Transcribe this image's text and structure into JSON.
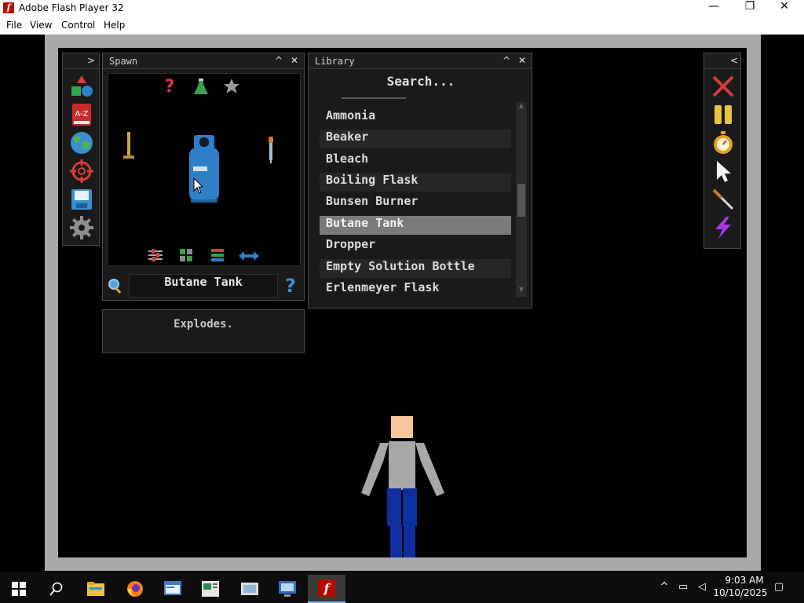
{
  "window": {
    "title": "Adobe Flash Player 32",
    "minimize_glyph": "—",
    "restore_glyph": "❐",
    "close_glyph": "✕"
  },
  "menu": [
    "File",
    "View",
    "Control",
    "Help"
  ],
  "categories": {
    "expand_glyph": ">",
    "icons": [
      "shapes-icon",
      "a-z-icon",
      "globe-icon",
      "crosshair-icon",
      "save-icon",
      "gear-icon"
    ],
    "az_label": "A-Z"
  },
  "spawn": {
    "title": "Spawn",
    "collapse_glyph": "^",
    "close_glyph": "✕",
    "selected_item": "Butane Tank",
    "description": "Explodes.",
    "help_glyph": "?",
    "random_glyph": "?"
  },
  "library": {
    "title": "Library",
    "collapse_glyph": "^",
    "close_glyph": "✕",
    "search_placeholder": "Search...",
    "items": [
      "Ammonia",
      "Beaker",
      "Bleach",
      "Boiling Flask",
      "Bunsen Burner",
      "Butane Tank",
      "Dropper",
      "Empty Solution Bottle",
      "Erlenmeyer Flask"
    ],
    "selected": "Butane Tank"
  },
  "tools": {
    "collapse_glyph": "<",
    "icons": [
      "clear-icon",
      "pause-icon",
      "timer-icon",
      "cursor-icon",
      "knife-icon",
      "lightning-icon"
    ]
  },
  "taskbar": {
    "time": "9:03 AM",
    "date": "10/10/2025",
    "apps": [
      "start-icon",
      "search-icon",
      "file-explorer-icon",
      "firefox-icon",
      "app-icon-1",
      "app-icon-2",
      "app-icon-3",
      "app-icon-4",
      "flash-player-icon"
    ]
  },
  "colors": {
    "accent_red": "#d93a3a",
    "tank_blue": "#2f7fc7",
    "highlight": "#7a7a7a",
    "stage_bg": "#000000"
  }
}
